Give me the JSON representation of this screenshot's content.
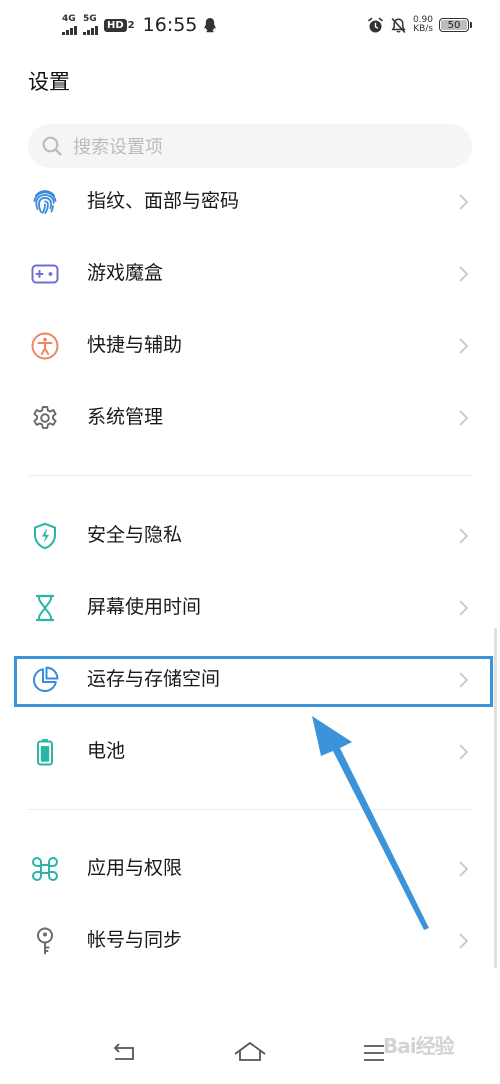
{
  "status_bar": {
    "sim1_label": "4G",
    "sim2_label": "5G",
    "hd_label": "HD",
    "hd_num": "2",
    "time": "16:55",
    "speed_value": "0.90",
    "speed_unit": "KB/s",
    "battery_level": "50"
  },
  "header": {
    "title": "设置"
  },
  "search": {
    "placeholder": "搜索设置项"
  },
  "groups": [
    {
      "items": [
        {
          "label": "指纹、面部与密码",
          "icon": "fingerprint-icon",
          "color": "#3a8bd8"
        },
        {
          "label": "游戏魔盒",
          "icon": "game-box-icon",
          "color": "#6f6fd6"
        },
        {
          "label": "快捷与辅助",
          "icon": "accessibility-icon",
          "color": "#f08463"
        },
        {
          "label": "系统管理",
          "icon": "gear-icon",
          "color": "#6b6b6b"
        }
      ]
    },
    {
      "items": [
        {
          "label": "安全与隐私",
          "icon": "shield-icon",
          "color": "#2ab5a5"
        },
        {
          "label": "屏幕使用时间",
          "icon": "hourglass-icon",
          "color": "#2ab5a5"
        },
        {
          "label": "运存与存储空间",
          "icon": "pie-chart-icon",
          "color": "#3a8bd8"
        },
        {
          "label": "电池",
          "icon": "battery-icon",
          "color": "#2ab5a5"
        }
      ]
    },
    {
      "items": [
        {
          "label": "应用与权限",
          "icon": "apps-icon",
          "color": "#2ab5a5"
        },
        {
          "label": "帐号与同步",
          "icon": "key-icon",
          "color": "#6b6b6b"
        }
      ]
    }
  ],
  "annotation": {
    "color": "#3b94d9"
  },
  "watermark": "Bai经验"
}
